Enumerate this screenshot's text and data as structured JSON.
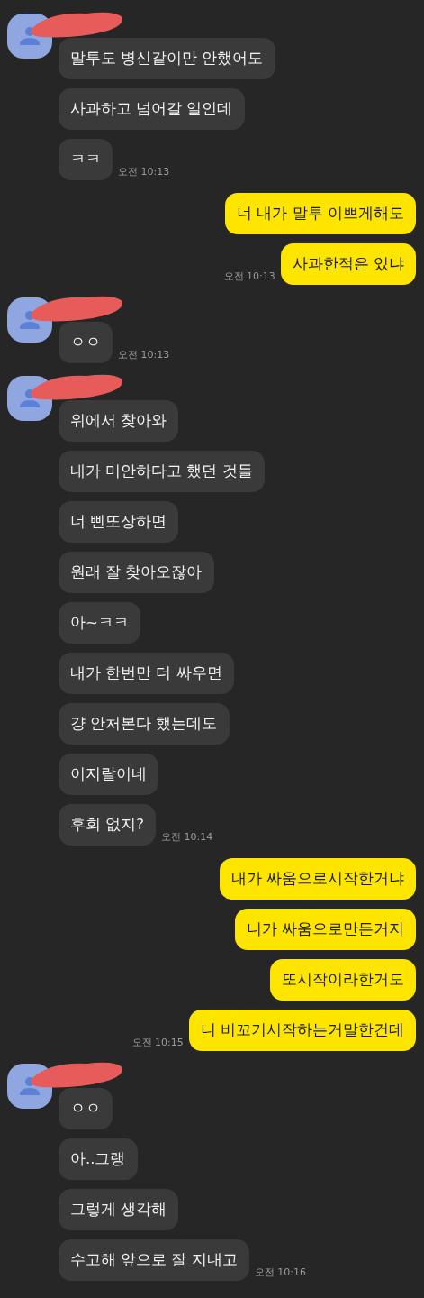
{
  "messages_groups": [
    {
      "kind": "other",
      "name_redacted": true,
      "messages": [
        "말투도 병신같이만 안했어도",
        "사과하고 넘어갈 일인데",
        "ㅋㅋ"
      ],
      "time": "오전 10:13"
    },
    {
      "kind": "me",
      "messages": [
        "너 내가 말투 이쁘게해도",
        "사과한적은 있냐"
      ],
      "time": "오전 10:13"
    },
    {
      "kind": "other",
      "name_redacted": true,
      "messages": [
        "ㅇㅇ"
      ],
      "time": "오전 10:13"
    },
    {
      "kind": "other",
      "name_redacted": true,
      "messages": [
        "위에서 찾아와",
        "내가 미안하다고 했던 것들",
        "너 삔또상하면",
        "원래 잘 찾아오잖아",
        "아~ㅋㅋ",
        "내가 한번만 더 싸우면",
        "걍 안처본다 했는데도",
        "이지랄이네",
        "후회 없지?"
      ],
      "time": "오전 10:14"
    },
    {
      "kind": "me",
      "messages": [
        "내가 싸움으로시작한거냐",
        "니가 싸움으로만든거지",
        "또시작이라한거도",
        "니 비꼬기시작하는거말한건데"
      ],
      "time": "오전 10:15"
    },
    {
      "kind": "other",
      "name_redacted": true,
      "messages": [
        "ㅇㅇ",
        "아..그랭",
        "그렇게 생각해",
        "수고해 앞으로 잘 지내고"
      ],
      "time": "오전 10:16"
    }
  ]
}
